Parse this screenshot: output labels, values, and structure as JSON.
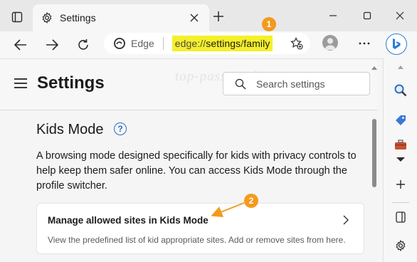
{
  "tab": {
    "title": "Settings"
  },
  "toolbar": {
    "edge_label": "Edge",
    "url_scheme": "edge://",
    "url_mid": "settings",
    "url_slash": "/",
    "url_end": "family"
  },
  "badges": {
    "first": "1",
    "second": "2"
  },
  "page": {
    "title": "Settings",
    "watermark": "top-password.com",
    "search_placeholder": "Search settings",
    "section_title": "Kids Mode",
    "help": "?",
    "description": "A browsing mode designed specifically for kids with privacy controls to help keep them safer online. You can access Kids Mode through the profile switcher.",
    "card": {
      "title": "Manage allowed sites in Kids Mode",
      "subtitle": "View the predefined list of kid appropriate sites. Add or remove sites from here."
    }
  },
  "colors": {
    "url_highlight": "#f5f02a",
    "badge": "#f39a1e",
    "accent": "#2a6fc9"
  },
  "icons": [
    "tab-actions-icon",
    "gear-icon",
    "close-icon",
    "plus-icon",
    "minimize-icon",
    "maximize-icon",
    "window-close-icon",
    "back-icon",
    "forward-icon",
    "refresh-icon",
    "edge-logo-icon",
    "favorite-add-icon",
    "profile-icon",
    "more-icon",
    "bing-icon",
    "search-icon",
    "tag-icon",
    "toolbox-icon",
    "chevron-down-icon",
    "split-screen-icon",
    "chevron-right-icon",
    "help-icon",
    "hamburger-icon"
  ]
}
